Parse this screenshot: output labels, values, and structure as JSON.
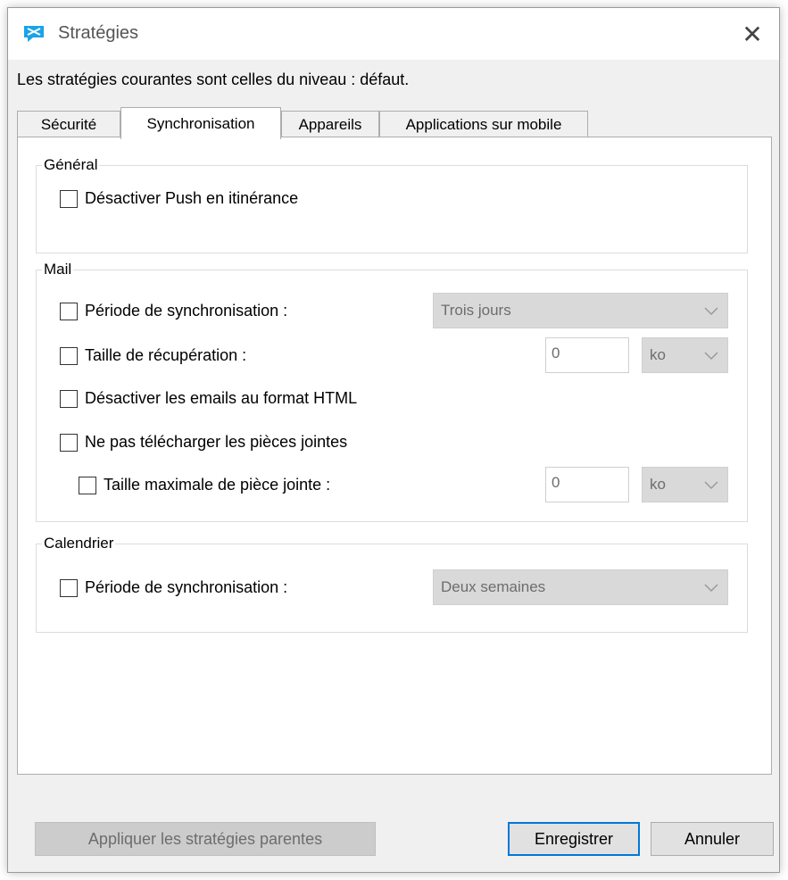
{
  "window": {
    "title": "Stratégies",
    "close_glyph": "✕"
  },
  "info_line": "Les stratégies courantes sont celles du niveau : défaut.",
  "tabs": [
    {
      "label": "Sécurité",
      "active": false
    },
    {
      "label": "Synchronisation",
      "active": true
    },
    {
      "label": "Appareils",
      "active": false
    },
    {
      "label": "Applications sur mobile",
      "active": false
    }
  ],
  "general": {
    "legend": "Général",
    "disable_push_roaming": {
      "label": "Désactiver Push en itinérance",
      "checked": false
    }
  },
  "mail": {
    "legend": "Mail",
    "sync_period": {
      "label": "Période de synchronisation :",
      "checked": false,
      "value": "Trois jours"
    },
    "retrieval_size": {
      "label": "Taille de récupération :",
      "checked": false,
      "value": "0",
      "unit": "ko"
    },
    "disable_html": {
      "label": "Désactiver les emails au format HTML",
      "checked": false
    },
    "no_attachments": {
      "label": "Ne pas télécharger les pièces jointes",
      "checked": false
    },
    "max_attachment": {
      "label": "Taille maximale de pièce jointe :",
      "checked": false,
      "value": "0",
      "unit": "ko"
    }
  },
  "calendar": {
    "legend": "Calendrier",
    "sync_period": {
      "label": "Période de synchronisation :",
      "checked": false,
      "value": "Deux semaines"
    }
  },
  "buttons": {
    "apply_parent": "Appliquer les stratégies parentes",
    "save": "Enregistrer",
    "cancel": "Annuler"
  },
  "colors": {
    "accent": "#0078d7",
    "icon_blue": "#1aa3e8",
    "disabled_bg": "#d9d9d9"
  }
}
